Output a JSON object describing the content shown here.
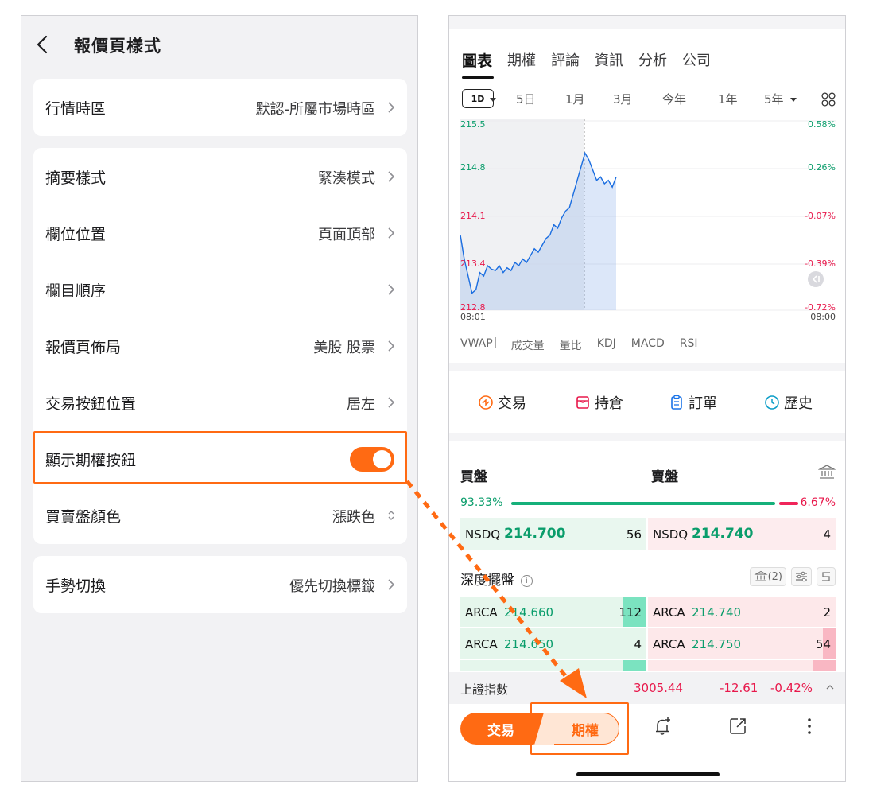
{
  "left": {
    "title": "報價頁樣式",
    "rows": [
      {
        "label": "行情時區",
        "value": "默認-所屬市場時區"
      },
      {
        "label": "摘要樣式",
        "value": "緊湊模式"
      },
      {
        "label": "欄位位置",
        "value": "頁面頂部"
      },
      {
        "label": "欄目順序",
        "value": ""
      },
      {
        "label": "報價頁佈局",
        "value": "美股 股票"
      },
      {
        "label": "交易按鈕位置",
        "value": "居左"
      },
      {
        "label": "顯示期權按鈕",
        "value": "",
        "toggle_on": true
      },
      {
        "label": "買賣盤顏色",
        "value": "漲跌色"
      },
      {
        "label": "手勢切換",
        "value": "優先切換標籤"
      }
    ]
  },
  "right": {
    "tabs": [
      "圖表",
      "期權",
      "評論",
      "資訊",
      "分析",
      "公司"
    ],
    "periods": [
      "1D",
      "5日",
      "1月",
      "3月",
      "今年",
      "1年",
      "5年"
    ],
    "indicators": [
      "VWAP",
      "成交量",
      "量比",
      "KDJ",
      "MACD",
      "RSI"
    ],
    "actions": [
      "交易",
      "持倉",
      "訂單",
      "歷史"
    ],
    "orderbook": {
      "bid_title": "買盤",
      "ask_title": "賣盤",
      "bid_pct": "93.33%",
      "ask_pct": "6.67%",
      "bid_ratio": 0.9333,
      "best_bid": {
        "exchange": "NSDQ",
        "price": "214.700",
        "size": "56"
      },
      "best_ask": {
        "exchange": "NSDQ",
        "price": "214.740",
        "size": "4"
      }
    },
    "depth": {
      "title": "深度擺盤",
      "bank_count": "(2)",
      "rows": [
        {
          "bid_ex": "ARCA",
          "bid_price": "214.660",
          "bid_size": "112",
          "ask_ex": "ARCA",
          "ask_price": "214.740",
          "ask_size": "2"
        },
        {
          "bid_ex": "ARCA",
          "bid_price": "214.650",
          "bid_size": "4",
          "ask_ex": "ARCA",
          "ask_price": "214.750",
          "ask_size": "54"
        }
      ]
    },
    "index": {
      "name": "上證指數",
      "value": "3005.44",
      "change": "-12.61",
      "pct": "-0.42%"
    },
    "bottom": {
      "trade_label": "交易",
      "options_label": "期權"
    },
    "chart_data": {
      "type": "line",
      "y_left_ticks": [
        "215.5",
        "214.8",
        "214.1",
        "213.4",
        "212.8"
      ],
      "y_right_ticks": [
        "0.58%",
        "0.26%",
        "-0.07%",
        "-0.39%",
        "-0.72%"
      ],
      "x_ticks": [
        "08:01",
        "08:00"
      ],
      "ylim": [
        212.8,
        215.5
      ],
      "series": [
        {
          "values": [
            213.9,
            213.55,
            213.3,
            213.05,
            213.1,
            213.35,
            213.3,
            213.45,
            213.4,
            213.38,
            213.45,
            213.35,
            213.42,
            213.38,
            213.5,
            213.45,
            213.55,
            213.5,
            213.6,
            213.7,
            213.65,
            213.75,
            213.85,
            213.9,
            214.05,
            214.0,
            214.15,
            214.25,
            214.3,
            214.5,
            214.7,
            214.9,
            215.1,
            215.0,
            214.85,
            214.7,
            214.75,
            214.65,
            214.7,
            214.6,
            214.75
          ]
        }
      ]
    }
  },
  "colors": {
    "accent": "#ff6a13",
    "up": "#0a9d6b",
    "down": "#e8184b"
  }
}
